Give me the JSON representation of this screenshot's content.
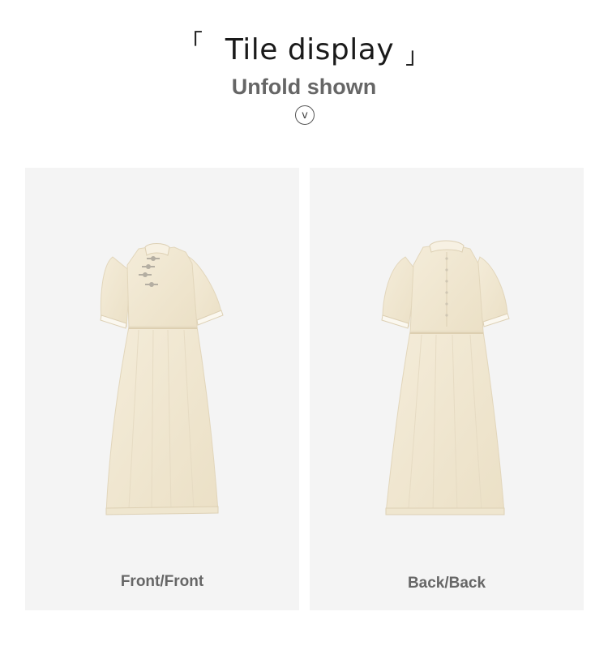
{
  "header": {
    "bracket_left": "「",
    "title": "Tile display",
    "bracket_right": "」",
    "subtitle": "Unfold shown",
    "expand_glyph": "v"
  },
  "panels": [
    {
      "caption": "Front/Front",
      "view": "front"
    },
    {
      "caption": "Back/Back",
      "view": "back"
    }
  ],
  "colors": {
    "panel_bg": "#f4f4f4",
    "dress_fabric": "#f1e8d3",
    "dress_shadow": "#e4d8bd",
    "button_knots": "#b4aea2",
    "caption_text": "#666666"
  }
}
